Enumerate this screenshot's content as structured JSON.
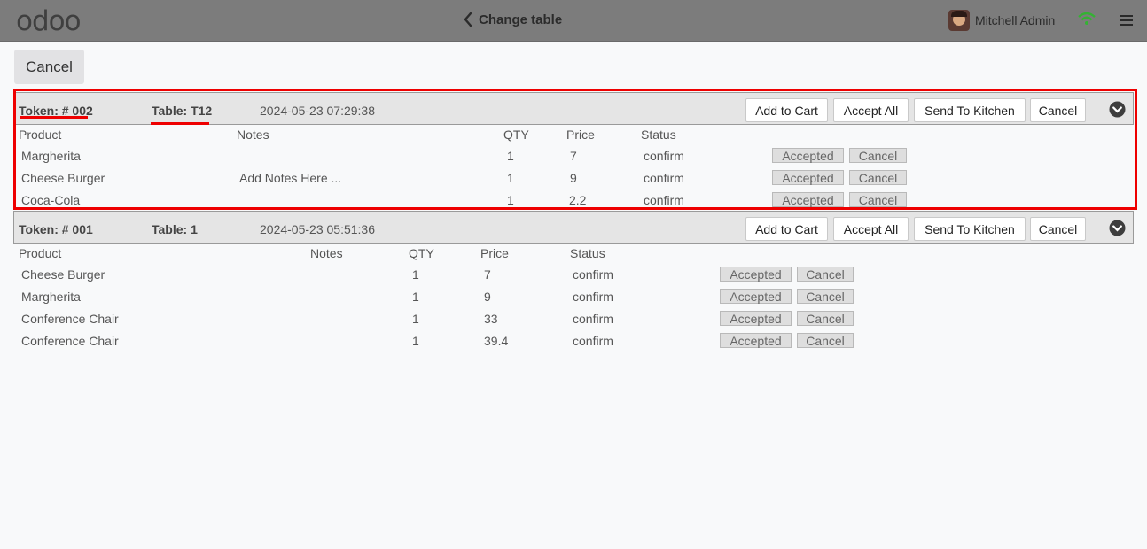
{
  "header": {
    "logo": "odoo",
    "back_label": "Change table",
    "user_name": "Mitchell Admin"
  },
  "top_cancel_label": "Cancel",
  "columns": [
    "Product",
    "Notes",
    "QTY",
    "Price",
    "Status"
  ],
  "actions": {
    "add_to_cart": "Add to Cart",
    "accept_all": "Accept All",
    "send_to_kitchen": "Send To Kitchen",
    "cancel": "Cancel",
    "accepted": "Accepted",
    "line_cancel": "Cancel"
  },
  "orders": [
    {
      "token": "Token: # 002",
      "table": "Table: T12",
      "datetime": "2024-05-23 07:29:38",
      "lines": [
        {
          "product": "Margherita",
          "notes": "",
          "qty": "1",
          "price": "7",
          "status": "confirm"
        },
        {
          "product": "Cheese Burger",
          "notes": "Add Notes Here ...",
          "qty": "1",
          "price": "9",
          "status": "confirm"
        },
        {
          "product": "Coca-Cola",
          "notes": "",
          "qty": "1",
          "price": "2.2",
          "status": "confirm"
        }
      ]
    },
    {
      "token": "Token: # 001",
      "table": "Table: 1",
      "datetime": "2024-05-23 05:51:36",
      "lines": [
        {
          "product": "Cheese Burger",
          "notes": "",
          "qty": "1",
          "price": "7",
          "status": "confirm"
        },
        {
          "product": "Margherita",
          "notes": "",
          "qty": "1",
          "price": "9",
          "status": "confirm"
        },
        {
          "product": "Conference Chair",
          "notes": "",
          "qty": "1",
          "price": "33",
          "status": "confirm"
        },
        {
          "product": "Conference Chair",
          "notes": "",
          "qty": "1",
          "price": "39.4",
          "status": "confirm"
        }
      ]
    }
  ],
  "colors": {
    "header_bg": "#7c7c7c",
    "highlight": "#ee0000",
    "wifi": "#34b233"
  }
}
